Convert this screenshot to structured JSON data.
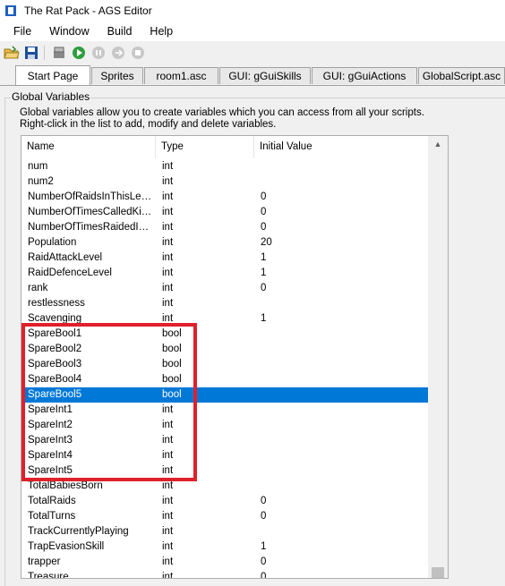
{
  "window": {
    "title": "The Rat Pack - AGS Editor"
  },
  "menu": [
    "File",
    "Window",
    "Build",
    "Help"
  ],
  "toolbar": {
    "buttons": [
      "open-folder-icon",
      "save-icon",
      "build-icon",
      "run-icon",
      "pause-icon",
      "step-icon",
      "stop-icon"
    ]
  },
  "tabs": [
    "Start Page",
    "Sprites",
    "room1.asc",
    "GUI: gGuiSkills",
    "GUI: gGuiActions",
    "GlobalScript.asc"
  ],
  "panel": {
    "group_title": "Global Variables",
    "description_line1": "Global variables allow you to create variables which you can access from all your scripts.",
    "description_line2": "Right-click in the list to add, modify and delete variables."
  },
  "list": {
    "columns": [
      "Name",
      "Type",
      "Initial Value"
    ],
    "rows": [
      [
        "num",
        "int",
        ""
      ],
      [
        "num2",
        "int",
        ""
      ],
      [
        "NumberOfRaidsInThisLevel",
        "int",
        "0"
      ],
      [
        "NumberOfTimesCalledKing...",
        "int",
        "0"
      ],
      [
        "NumberOfTimesRaidedInT...",
        "int",
        "0"
      ],
      [
        "Population",
        "int",
        "20"
      ],
      [
        "RaidAttackLevel",
        "int",
        "1"
      ],
      [
        "RaidDefenceLevel",
        "int",
        "1"
      ],
      [
        "rank",
        "int",
        "0"
      ],
      [
        "restlessness",
        "int",
        ""
      ],
      [
        "Scavenging",
        "int",
        "1"
      ],
      [
        "SpareBool1",
        "bool",
        ""
      ],
      [
        "SpareBool2",
        "bool",
        ""
      ],
      [
        "SpareBool3",
        "bool",
        ""
      ],
      [
        "SpareBool4",
        "bool",
        ""
      ],
      [
        "SpareBool5",
        "bool",
        ""
      ],
      [
        "SpareInt1",
        "int",
        ""
      ],
      [
        "SpareInt2",
        "int",
        ""
      ],
      [
        "SpareInt3",
        "int",
        ""
      ],
      [
        "SpareInt4",
        "int",
        ""
      ],
      [
        "SpareInt5",
        "int",
        ""
      ],
      [
        "TotalBabiesBorn",
        "int",
        ""
      ],
      [
        "TotalRaids",
        "int",
        "0"
      ],
      [
        "TotalTurns",
        "int",
        "0"
      ],
      [
        "TrackCurrentlyPlaying",
        "int",
        ""
      ],
      [
        "TrapEvasionSkill",
        "int",
        "1"
      ],
      [
        "trapper",
        "int",
        "0"
      ],
      [
        "Treasure",
        "int",
        "0"
      ]
    ],
    "selected_index": 15
  },
  "colors": {
    "selection": "#0078d7",
    "highlight_box": "#e0202a"
  }
}
